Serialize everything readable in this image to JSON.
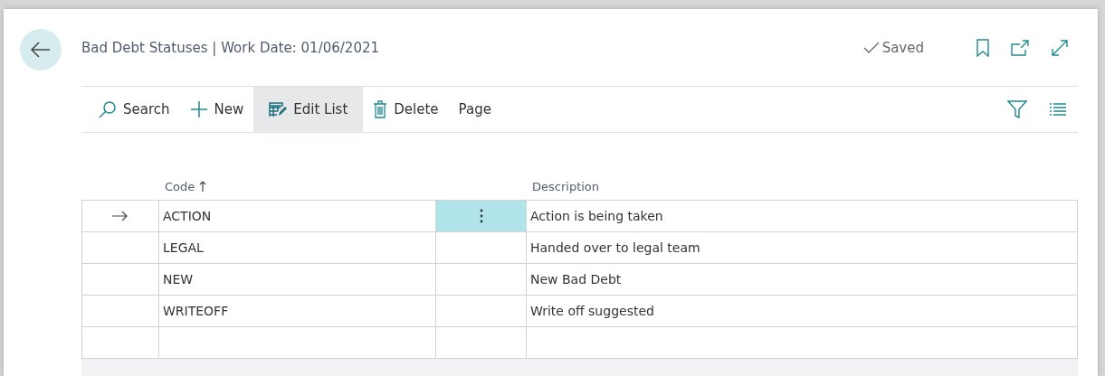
{
  "page": {
    "title": "Bad Debt Statuses | Work Date: 01/06/2021",
    "status": "Saved"
  },
  "actions": [
    {
      "label": "Search",
      "selected": false
    },
    {
      "label": "New",
      "selected": false
    },
    {
      "label": "Edit List",
      "selected": true
    },
    {
      "label": "Delete",
      "selected": false
    },
    {
      "label": "Page",
      "selected": false
    }
  ],
  "columns": [
    {
      "label": "Code"
    },
    {
      "label": "Description"
    }
  ],
  "rows": [
    {
      "code": "ACTION",
      "description": "Action is being taken",
      "selected": true
    },
    {
      "code": "LEGAL",
      "description": "Handed over to legal team",
      "selected": false
    },
    {
      "code": "NEW",
      "description": "New Bad Debt",
      "selected": false
    },
    {
      "code": "WRITEOFF",
      "description": "Write off suggested",
      "selected": false
    }
  ]
}
